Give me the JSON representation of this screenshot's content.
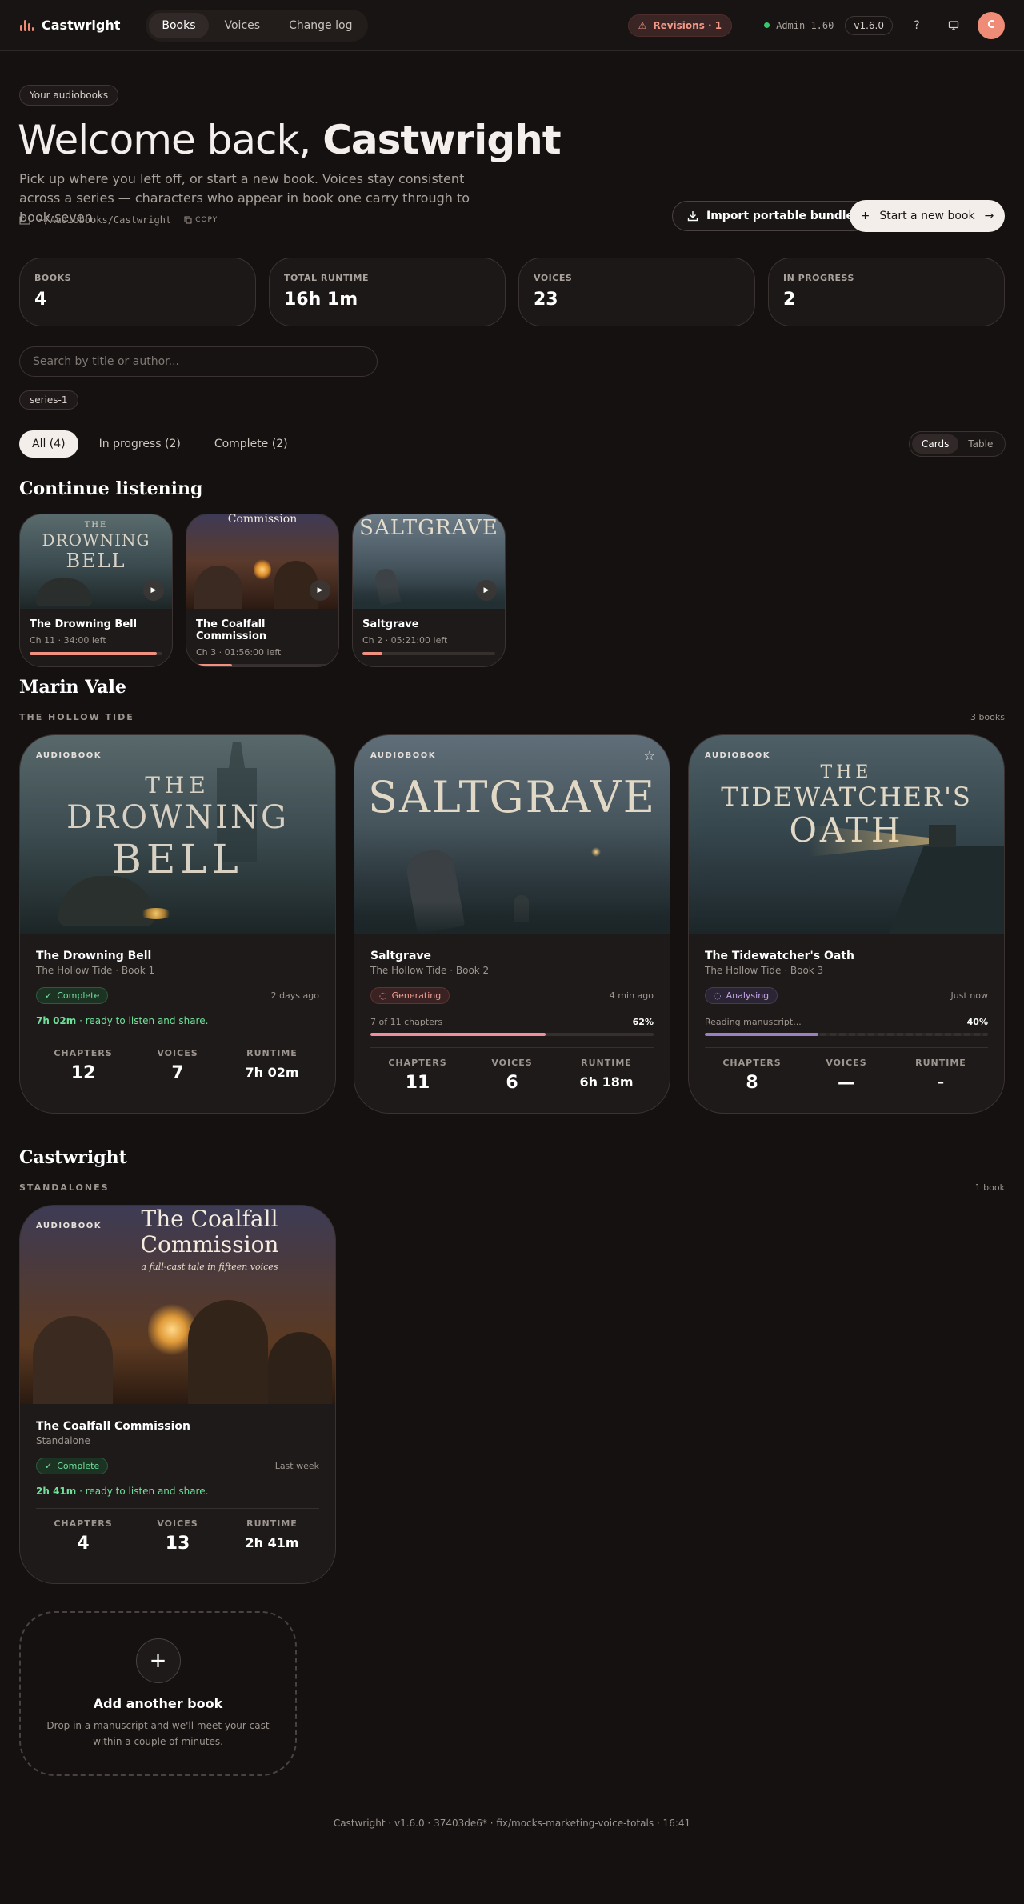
{
  "topbar": {
    "brand": "Castwright",
    "nav": [
      {
        "label": "Books",
        "active": true
      },
      {
        "label": "Voices",
        "active": false
      },
      {
        "label": "Change log",
        "active": false
      }
    ],
    "revisions": "Revisions · 1",
    "admin": "Admin 1.60",
    "version": "v1.6.0",
    "help": "?",
    "avatar": "C"
  },
  "hero": {
    "eyebrow": "Your audiobooks",
    "title_lead": "Welcome back,",
    "title_name": "Castwright",
    "subtitle": "Pick up where you left off, or start a new book. Voices stay consistent across a series — characters who appear in book one carry through to book seven.",
    "path": "~/Audiobooks/Castwright",
    "copy": "COPY",
    "import_label": "Import portable bundle",
    "start_label": "Start a new book"
  },
  "stats": [
    {
      "label": "BOOKS",
      "value": "4"
    },
    {
      "label": "TOTAL RUNTIME",
      "value": "16h 1m"
    },
    {
      "label": "VOICES",
      "value": "23"
    },
    {
      "label": "IN PROGRESS",
      "value": "2"
    }
  ],
  "search": {
    "placeholder": "Search by title or author..."
  },
  "tag_chip": "series-1",
  "filters": [
    {
      "label": "All (4)",
      "active": true
    },
    {
      "label": "In progress (2)",
      "active": false
    },
    {
      "label": "Complete (2)",
      "active": false
    }
  ],
  "view_toggle": [
    {
      "label": "Cards",
      "active": true
    },
    {
      "label": "Table",
      "active": false
    }
  ],
  "continue_listening": {
    "heading": "Continue listening",
    "items": [
      {
        "title": "The Drowning Bell",
        "sub": "Ch 11 · 34:00 left",
        "progress": 0.96,
        "art_text": [
          "THE",
          "DROWNING",
          "BELL"
        ]
      },
      {
        "title": "The Coalfall Commission",
        "sub": "Ch 3 · 01:56:00 left",
        "progress": 0.27,
        "art_text": [
          "Commission"
        ]
      },
      {
        "title": "Saltgrave",
        "sub": "Ch 2 · 05:21:00 left",
        "progress": 0.15,
        "art_text": [
          "SALTGRAVE"
        ]
      }
    ]
  },
  "groups": [
    {
      "author": "Marin Vale",
      "series": "THE HOLLOW TIDE",
      "count": "3 books",
      "books": [
        {
          "tag": "AUDIOBOOK",
          "art_text": [
            "THE",
            "DROWNING",
            "BELL"
          ],
          "title": "The Drowning Bell",
          "sub": "The Hollow Tide · Book 1",
          "status": "Complete",
          "when": "2 days ago",
          "ready_time": "7h 02m",
          "ready_text": " · ready to listen and share.",
          "metrics": [
            {
              "label": "CHAPTERS",
              "value": "12"
            },
            {
              "label": "VOICES",
              "value": "7"
            },
            {
              "label": "RUNTIME",
              "value": "7h 02m"
            }
          ]
        },
        {
          "tag": "AUDIOBOOK",
          "art_text": [
            "SALTGRAVE"
          ],
          "title": "Saltgrave",
          "sub": "The Hollow Tide · Book 2",
          "status": "Generating",
          "when": "4 min ago",
          "progress_label": "7 of 11 chapters",
          "progress_pct": "62%",
          "progress": 0.62,
          "metrics": [
            {
              "label": "CHAPTERS",
              "value": "11"
            },
            {
              "label": "VOICES",
              "value": "6"
            },
            {
              "label": "RUNTIME",
              "value": "6h 18m"
            }
          ]
        },
        {
          "tag": "AUDIOBOOK",
          "art_text": [
            "THE",
            "TIDEWATCHER'S",
            "OATH"
          ],
          "title": "The Tidewatcher's Oath",
          "sub": "The Hollow Tide · Book 3",
          "status": "Analysing",
          "when": "Just now",
          "progress_label": "Reading manuscript...",
          "progress_pct": "40%",
          "progress": 0.4,
          "metrics": [
            {
              "label": "CHAPTERS",
              "value": "8"
            },
            {
              "label": "VOICES",
              "value": "—"
            },
            {
              "label": "RUNTIME",
              "value": "–"
            }
          ]
        }
      ]
    },
    {
      "author": "Castwright",
      "series": "STANDALONES",
      "count": "1 book",
      "books": [
        {
          "tag": "AUDIOBOOK",
          "art_text": [
            "The Coalfall",
            "Commission",
            "a full-cast tale in fifteen voices"
          ],
          "title": "The Coalfall Commission",
          "sub": "Standalone",
          "status": "Complete",
          "when": "Last week",
          "ready_time": "2h 41m",
          "ready_text": " · ready to listen and share.",
          "metrics": [
            {
              "label": "CHAPTERS",
              "value": "4"
            },
            {
              "label": "VOICES",
              "value": "13"
            },
            {
              "label": "RUNTIME",
              "value": "2h 41m"
            }
          ]
        }
      ]
    }
  ],
  "add_card": {
    "plus": "+",
    "title": "Add another book",
    "desc": "Drop in a manuscript and we'll meet your cast within a couple of minutes."
  },
  "footer": "Castwright · v1.6.0 · 37403de6* · fix/mocks-marketing-voice-totals · 16:41",
  "colors": {
    "accent": "#f08a75",
    "complete": "#6fe09a",
    "generating_bar": "#ef8f9e",
    "analysing_bar": "#9a7fc4"
  }
}
